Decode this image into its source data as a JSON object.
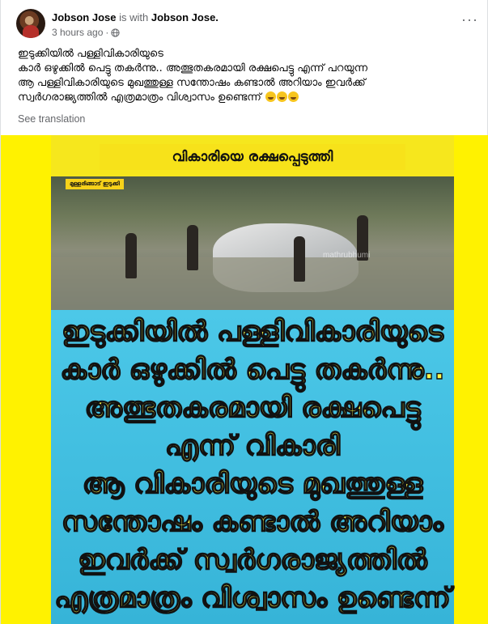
{
  "post": {
    "author": "Jobson Jose",
    "with_text": "is with",
    "tagged": "Jobson Jose.",
    "time": "3 hours ago",
    "privacy_icon": "globe-icon",
    "more_icon": "more-options-icon",
    "more_label": "···",
    "caption_lines": [
      "ഇടുക്കിയിൽ പള്ളിവികാരിയുടെ",
      "കാർ  ഒഴുക്കിൽ പെട്ടു തകർന്നു.. അത്ഭുതകരമായി രക്ഷപെട്ടു എന്ന് പറയുന്ന",
      "ആ പള്ളിവികാരിയുടെ മുഖത്തുള്ള സന്തോഷം കണ്ടാൽ അറിയാം ഇവർക്ക്",
      "സ്വർഗരാജ്യത്തിൽ എത്രമാത്രം വിശ്വാസം ഉണ്ടെന്ന്"
    ],
    "see_translation": "See translation"
  },
  "image": {
    "banner": "വികാരിയെ രക്ഷപ്പെടുത്തി",
    "location_tag": "മുള്ളരിങ്ങാട് ഇടുക്കി",
    "watermark": "mathrubhumi",
    "big_lines": [
      "ഇടുക്കിയിൽ പള്ളിവികാരിയുടെ",
      "കാർ  ഒഴുക്കിൽ പെട്ടു തകർന്നു..",
      "അത്ഭുതകരമായി രക്ഷപെട്ടു",
      "എന്ന് വികാരി",
      "ആ വികാരിയുടെ മുഖത്തുള്ള",
      "സന്തോഷം കണ്ടാൽ അറിയാം",
      "ഇവർക്ക് സ്വർഗരാജ്യത്തിൽ",
      "എത്രമാത്രം വിശ്വാസം ഉണ്ടെന്ന്"
    ],
    "colors": {
      "background": "#fff200",
      "panel": "#3cbfe0",
      "text": "#fff94a"
    }
  }
}
